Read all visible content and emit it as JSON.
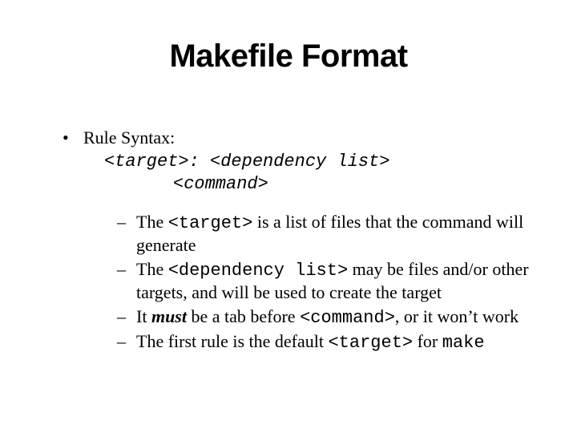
{
  "title": "Makefile Format",
  "bullet1_label": "Rule Syntax:",
  "syntax": {
    "line1": "<target>: <dependency list>",
    "line2": "<command>"
  },
  "sub": {
    "s1_a": "The ",
    "s1_code": "<target>",
    "s1_b": " is a list of files that the command will generate",
    "s2_a": "The ",
    "s2_code": "<dependency list>",
    "s2_b": " may be files and/or other targets, and will be used to create the target",
    "s3_a": "It ",
    "s3_em": "must",
    "s3_b": " be a tab before ",
    "s3_code": "<command>",
    "s3_c": ", or it won’t work",
    "s4_a": "The first rule is the default ",
    "s4_code": "<target>",
    "s4_b": " for ",
    "s4_code2": "make"
  }
}
